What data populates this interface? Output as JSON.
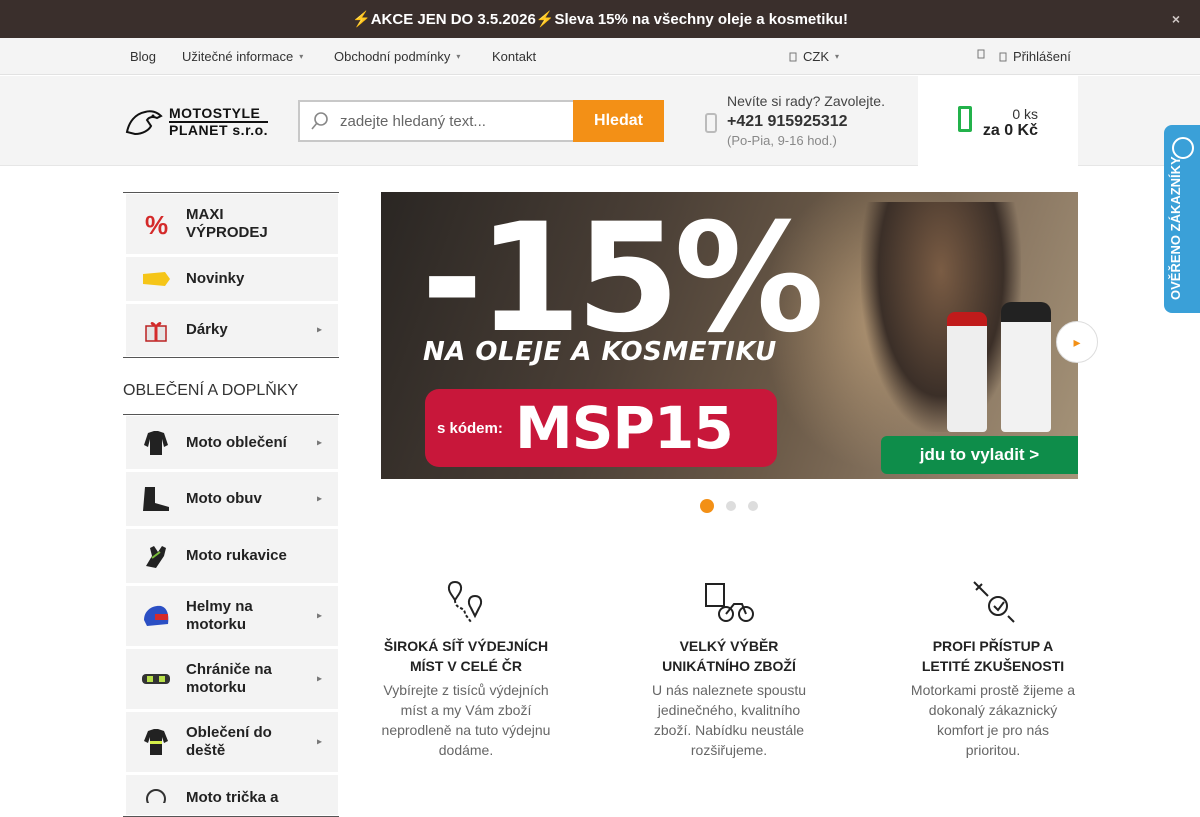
{
  "promo": {
    "text": "⚡AKCE JEN DO 3.5.2026⚡Sleva 15% na všechny oleje a kosmetiku!",
    "close": "×"
  },
  "utilnav": {
    "items": [
      {
        "label": "Blog"
      },
      {
        "label": "Užitečné informace"
      },
      {
        "label": "Obchodní podmínky"
      },
      {
        "label": "Kontakt"
      }
    ],
    "currency": "CZK",
    "login": "Přihlášení"
  },
  "logo": {
    "line1": "MOTOSTYLE",
    "line2": "PLANET s.r.o."
  },
  "search": {
    "placeholder": "zadejte hledaný text...",
    "button": "Hledat"
  },
  "help": {
    "line1": "Nevíte si rady? Zavolejte.",
    "phone": "+421 915925312",
    "hours": "(Po-Pia, 9-16 hod.)"
  },
  "cart": {
    "qty": "0 ks",
    "price": "za 0 Kč"
  },
  "sidebar": {
    "top": [
      {
        "label": "MAXI VÝPRODEJ",
        "icon": "percent-icon"
      },
      {
        "label": "Novinky",
        "icon": "new-tag-icon"
      },
      {
        "label": "Dárky",
        "icon": "gift-icon"
      }
    ],
    "heading": "OBLEČENÍ A DOPLŇKY",
    "categories": [
      {
        "label": "Moto oblečení",
        "icon": "jacket-icon"
      },
      {
        "label": "Moto obuv",
        "icon": "boot-icon"
      },
      {
        "label": "Moto rukavice",
        "icon": "glove-icon"
      },
      {
        "label": "Helmy na motorku",
        "icon": "helmet-icon"
      },
      {
        "label": "Chrániče na motorku",
        "icon": "protector-icon"
      },
      {
        "label": "Oblečení do deště",
        "icon": "rainsuit-icon"
      },
      {
        "label": "Moto trička a",
        "icon": "tshirt-icon"
      }
    ]
  },
  "banner": {
    "big": "-15%",
    "sub": "NA OLEJE A KOSMETIKU",
    "code_prefix": "s kódem:",
    "code": "MSP15",
    "cta": "jdu to vyladit >"
  },
  "slider": {
    "dots": 3,
    "active": 0
  },
  "badge": {
    "text": "OVĚŘENO ZÁKAZNÍKY"
  },
  "features": [
    {
      "title": "ŠIROKÁ SÍŤ VÝDEJNÍCH MÍST V CELÉ ČR",
      "text": "Vybírejte z tisíců výdejních míst a my Vám zboží neprodleně na tuto výdejnu dodáme.",
      "icon": "map-pin-icon"
    },
    {
      "title": "VELKÝ VÝBĚR UNIKÁTNÍHO ZBOŽÍ",
      "text": "U nás naleznete spoustu jedinečného, kvalitního zboží. Nabídku neustále rozšiřujeme.",
      "icon": "motorbike-icon"
    },
    {
      "title": "PROFI PŘÍSTUP A LETITÉ ZKUŠENOSTI",
      "text": "Motorkami prostě žijeme a dokonalý zákaznický komfort je pro nás prioritou.",
      "icon": "tools-icon"
    }
  ],
  "colors": {
    "accent": "#f39016",
    "promo_bg": "#3a2f2c",
    "cart_green": "#23b24b",
    "banner_red": "#c8173a",
    "banner_green": "#0e8d4a",
    "badge_blue": "#3aa0d8"
  }
}
